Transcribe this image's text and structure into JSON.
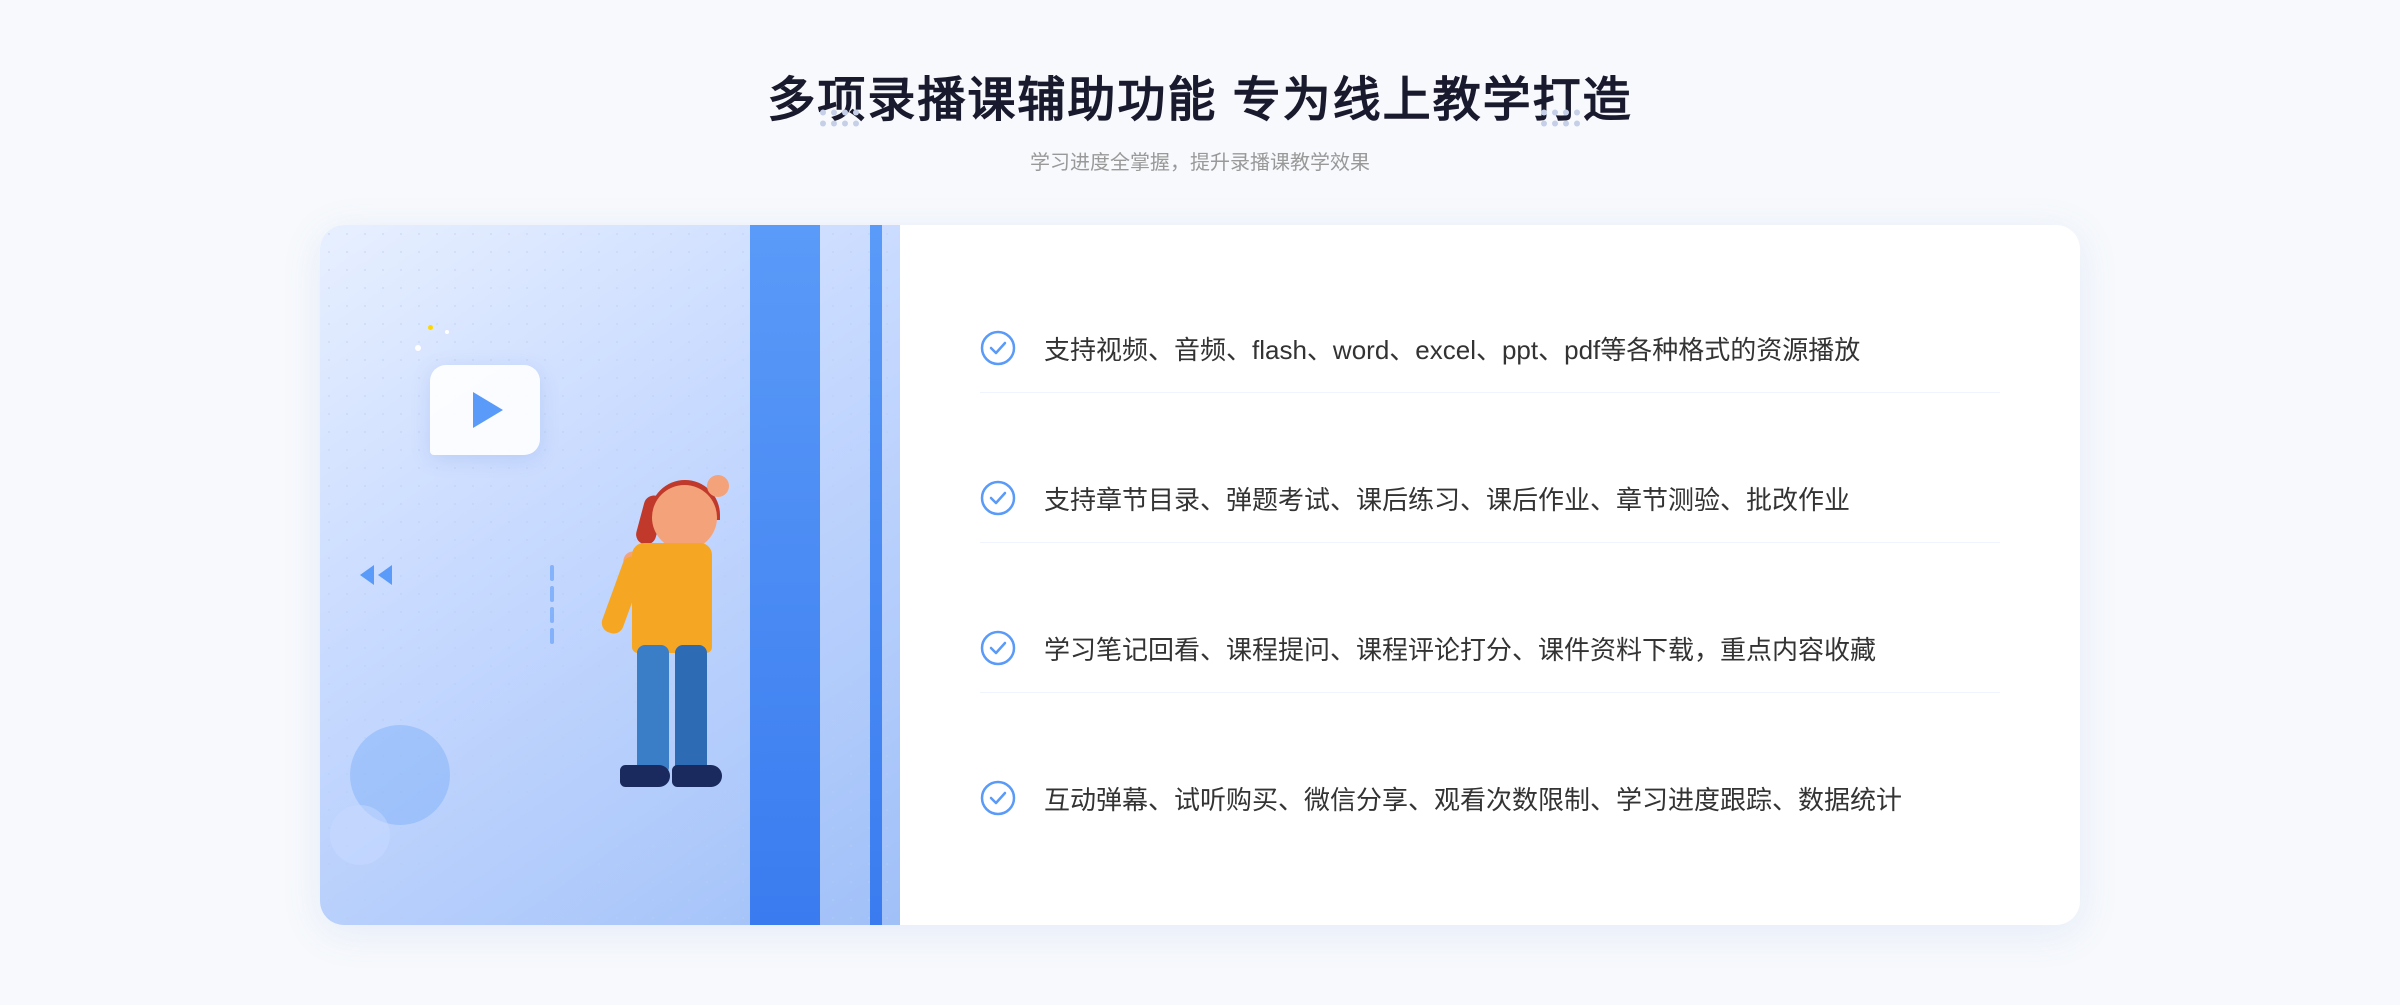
{
  "header": {
    "main_title": "多项录播课辅助功能 专为线上教学打造",
    "sub_title": "学习进度全掌握，提升录播课教学效果"
  },
  "features": [
    {
      "id": 1,
      "text": "支持视频、音频、flash、word、excel、ppt、pdf等各种格式的资源播放"
    },
    {
      "id": 2,
      "text": "支持章节目录、弹题考试、课后练习、课后作业、章节测验、批改作业"
    },
    {
      "id": 3,
      "text": "学习笔记回看、课程提问、课程评论打分、课件资料下载，重点内容收藏"
    },
    {
      "id": 4,
      "text": "互动弹幕、试听购买、微信分享、观看次数限制、学习进度跟踪、数据统计"
    }
  ],
  "colors": {
    "accent_blue": "#5a9af8",
    "primary_blue": "#3a7cf0",
    "check_color": "#5a9af8"
  }
}
